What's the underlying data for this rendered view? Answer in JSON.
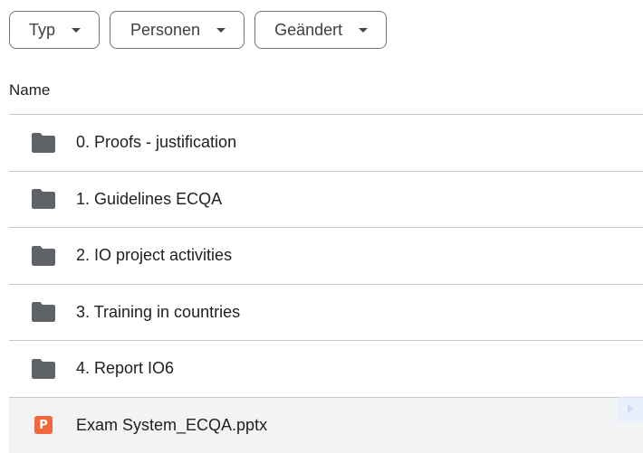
{
  "filters": {
    "type_label": "Typ",
    "people_label": "Personen",
    "modified_label": "Geändert"
  },
  "list_header": {
    "name_label": "Name"
  },
  "items": [
    {
      "name": "0. Proofs - justification",
      "icon": "folder-icon"
    },
    {
      "name": "1. Guidelines ECQA",
      "icon": "folder-icon"
    },
    {
      "name": "2. IO project activities",
      "icon": "folder-icon"
    },
    {
      "name": "3. Training in countries",
      "icon": "folder-icon"
    },
    {
      "name": "4. Report IO6",
      "icon": "folder-icon"
    },
    {
      "name": "Exam System_ECQA.pptx",
      "icon": "powerpoint-file-icon",
      "icon_letter": "P",
      "highlighted": true
    }
  ],
  "colors": {
    "folder": "#5f6368",
    "powerpoint": "#f2673b",
    "divider": "#c4c7c5",
    "highlight_row": "#f1f3f4"
  }
}
